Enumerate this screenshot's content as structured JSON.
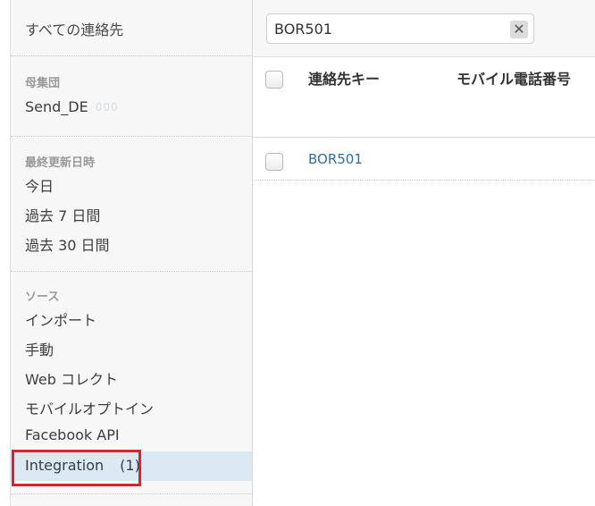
{
  "sidebar": {
    "all_contacts": "すべての連絡先",
    "population": {
      "heading": "母集団",
      "items": [
        {
          "label": "Send_DE",
          "badge": "000"
        }
      ]
    },
    "last_updated": {
      "heading": "最終更新日時",
      "items": [
        {
          "label": "今日"
        },
        {
          "label": "過去 7 日間"
        },
        {
          "label": "過去 30 日間"
        }
      ]
    },
    "source": {
      "heading": "ソース",
      "items": [
        {
          "label": "インポート"
        },
        {
          "label": "手動"
        },
        {
          "label": "Web コレクト"
        },
        {
          "label": "モバイルオプトイン"
        },
        {
          "label": "Facebook API"
        }
      ],
      "selected": {
        "label": "Integration",
        "count": "(1)"
      }
    }
  },
  "search": {
    "value": "BOR501",
    "clear_icon": "close-icon"
  },
  "table": {
    "columns": [
      "連絡先キー",
      "モバイル電話番号"
    ],
    "rows": [
      {
        "contact_key": "BOR501",
        "mobile": ""
      }
    ]
  },
  "colors": {
    "link": "#2f6d9e",
    "selected_bg": "#dbe9f4",
    "highlight": "#e0202c"
  }
}
